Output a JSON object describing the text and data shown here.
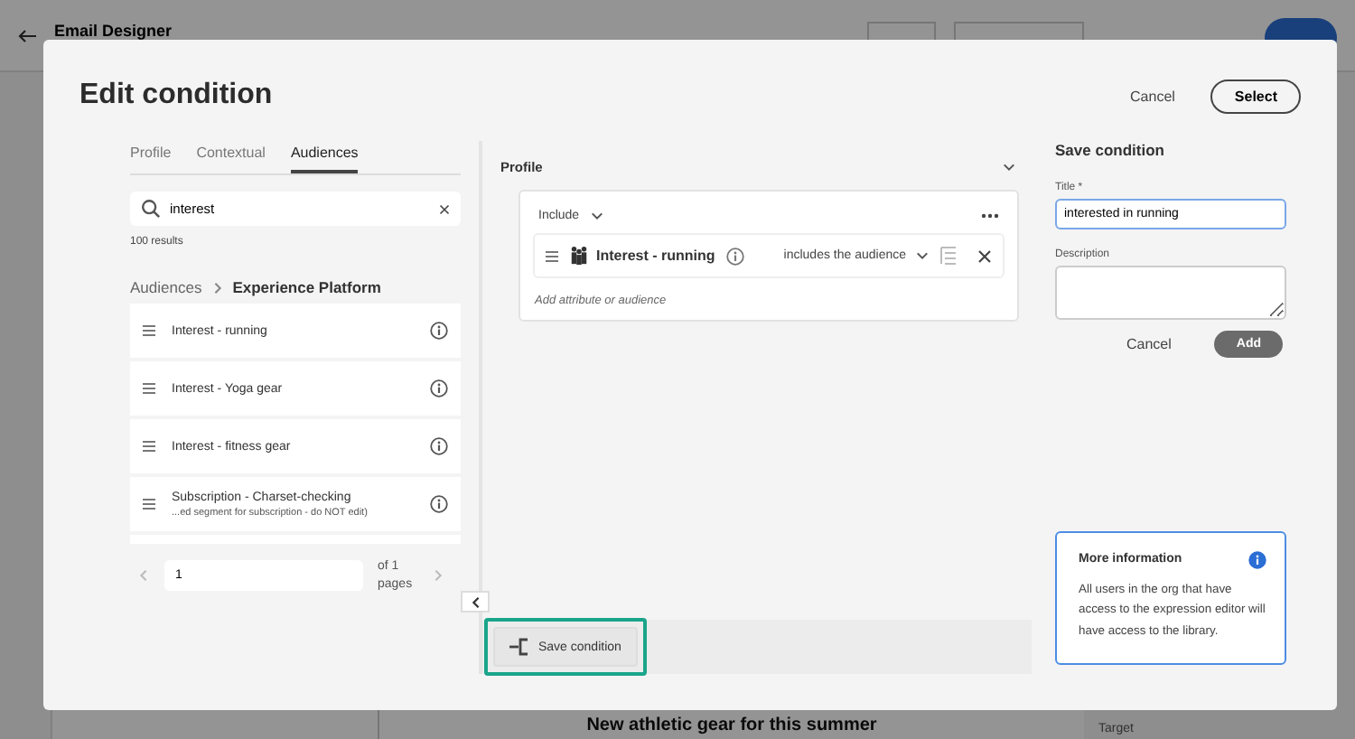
{
  "app": {
    "title": "Email Designer",
    "preview_heading": "New athletic gear for this summer",
    "side_label": "Target"
  },
  "dialog": {
    "title": "Edit condition",
    "cancel": "Cancel",
    "select": "Select"
  },
  "tabs": [
    {
      "label": "Profile",
      "selected": false
    },
    {
      "label": "Contextual",
      "selected": false
    },
    {
      "label": "Audiences",
      "selected": true
    }
  ],
  "search": {
    "value": "interest"
  },
  "result_count": "100 results",
  "breadcrumb": [
    "Audiences",
    "Experience Platform"
  ],
  "audiences": [
    {
      "name": "Interest - running"
    },
    {
      "name": "Interest - Yoga gear"
    },
    {
      "name": "Interest - fitness gear"
    },
    {
      "name": "Subscription - Charset-checking",
      "detail": "...ed segment for subscription - do NOT edit)"
    }
  ],
  "pager": {
    "value": "1",
    "total": "of 1 pages"
  },
  "profile": {
    "heading": "Profile",
    "operator": "Include",
    "audience": "Interest - running",
    "relation": "includes the audience",
    "add_placeholder": "Add attribute or audience"
  },
  "save_condition_button": {
    "label": "Save condition",
    "highlighted": true
  },
  "save_panel": {
    "heading": "Save condition",
    "title_label": "Title *",
    "title_value": "interested in running",
    "description_label": "Description",
    "cancel": "Cancel",
    "add": "Add"
  },
  "info": {
    "heading": "More information",
    "text": "All users in the org that have access to the expression editor will have access to the library."
  }
}
